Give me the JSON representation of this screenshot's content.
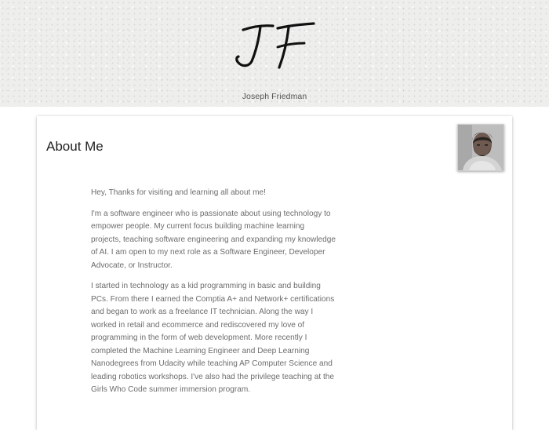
{
  "header": {
    "logo_text": "JF",
    "author_name": "Joseph Friedman"
  },
  "about": {
    "title": "About Me",
    "avatar_icon": "portrait-photo",
    "paragraphs": [
      "Hey, Thanks for visiting and learning all about me!",
      "I'm a software engineer who is passionate about using technology to empower people. My current focus building machine learning projects, teaching software engineering and expanding my knowledge of AI. I am open to my next role as a Software Engineer, Developer Advocate, or Instructor.",
      "I started in technology as a kid programming in basic and building PCs. From there I earned the Comptia A+ and Network+ certifications and began to work as a freelance IT technician. Along the way I worked in retail and ecommerce and rediscovered my love of programming in the form of web development. More recently I completed the Machine Learning Engineer and Deep Learning Nanodegrees from Udacity while teaching AP Computer Science and leading robotics workshops. I've also had the privilege teaching at the Girls Who Code summer immersion program."
    ]
  }
}
